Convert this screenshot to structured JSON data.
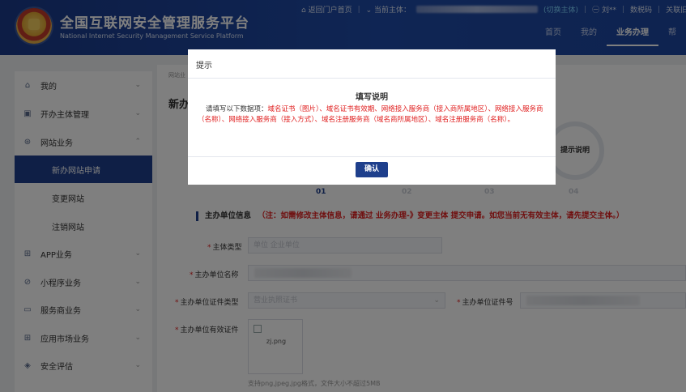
{
  "header": {
    "title_cn": "全国互联网安全管理服务平台",
    "title_en": "National Internet Security Management Service Platform",
    "back_portal": "⌂ 返回门户首页",
    "current_subject_label": "⌄ 当前主体：",
    "switch_subject": "(切换主体)",
    "user": "㊀ 刘**",
    "digital_code": "数税码",
    "close_old_account": "关联旧账号",
    "nav": [
      "首页",
      "我的",
      "业务办理",
      "帮"
    ]
  },
  "sidebar": {
    "items": [
      {
        "icon": "home-icon",
        "glyph": "⌂",
        "label": "我的",
        "chev": "⌄"
      },
      {
        "icon": "briefcase-icon",
        "glyph": "▣",
        "label": "开办主体管理",
        "chev": "⌄"
      },
      {
        "icon": "globe-icon",
        "glyph": "⊛",
        "label": "网站业务",
        "chev": "⌃"
      },
      {
        "label": "新办网站申请"
      },
      {
        "label": "变更网站"
      },
      {
        "label": "注销网站"
      },
      {
        "icon": "grid-icon",
        "glyph": "⊞",
        "label": "APP业务",
        "chev": "⌄"
      },
      {
        "icon": "miniprogram-icon",
        "glyph": "⊘",
        "label": "小程序业务",
        "chev": "⌄"
      },
      {
        "icon": "monitor-icon",
        "glyph": "▭",
        "label": "服务商业务",
        "chev": "⌄"
      },
      {
        "icon": "apps-icon",
        "glyph": "⊞",
        "label": "应用市场业务",
        "chev": "⌄"
      },
      {
        "icon": "shield-icon",
        "glyph": "◈",
        "label": "安全评估",
        "chev": "⌄"
      }
    ]
  },
  "content": {
    "breadcrumb": "网站业",
    "page_title": "新办",
    "step_circle": "提示说明",
    "steps": [
      "01",
      "02",
      "03",
      "04"
    ],
    "section_title": "主办单位信息",
    "section_note": "（注：如需修改主体信息，请通过 业务办理-》变更主体 提交申请。如您当前无有效主体，请先提交主体。）",
    "fields": {
      "subject_type_label": "主体类型",
      "subject_type_value": "单位 企业单位",
      "org_name_label": "主办单位名称",
      "cert_type_label": "主办单位证件类型",
      "cert_type_value": "营业执照证书",
      "cert_no_label": "主办单位证件号",
      "cert_valid_label": "主办单位有效证件"
    },
    "upload_filename": "zj.png",
    "upload_hint": "支持png,jpeg,jpg格式，文件大小不超过5MB"
  },
  "modal": {
    "title": "提示",
    "heading": "填写说明",
    "lead": "请填写以下数据项：",
    "items": "域名证书（图片）、域名证书有效期、网络接入服务商（接入商所属地区）、网络接入服务商（名称）、网络接入服务商（接入方式）、域名注册服务商（域名商所属地区）、域名注册服务商（名称）。",
    "confirm": "确认"
  }
}
